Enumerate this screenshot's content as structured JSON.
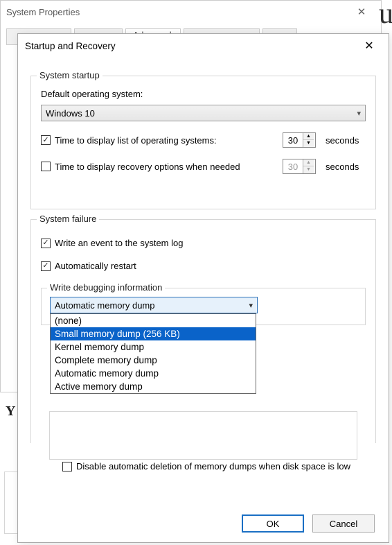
{
  "back_window": {
    "title": "System Properties",
    "tabs": {
      "advanced": "Advanced"
    }
  },
  "dialog": {
    "title": "Startup and Recovery"
  },
  "startup": {
    "group_label": "System startup",
    "default_os_label": "Default operating system:",
    "default_os_value": "Windows 10",
    "display_list_label": "Time to display list of operating systems:",
    "display_list_checked": true,
    "display_list_seconds": "30",
    "recovery_label": "Time to display recovery options when needed",
    "recovery_checked": false,
    "recovery_seconds": "30",
    "unit": "seconds"
  },
  "failure": {
    "group_label": "System failure",
    "write_event_label": "Write an event to the system log",
    "write_event_checked": true,
    "auto_restart_label": "Automatically restart",
    "auto_restart_checked": true,
    "debug_group_label": "Write debugging information",
    "combo_value": "Automatic memory dump",
    "combo_options": [
      "(none)",
      "Small memory dump (256 KB)",
      "Kernel memory dump",
      "Complete memory dump",
      "Automatic memory dump",
      "Active memory dump"
    ],
    "combo_highlight_index": 1,
    "disable_auto_delete_label": "Disable automatic deletion of memory dumps when disk space is low",
    "disable_auto_delete_checked": false
  },
  "buttons": {
    "ok": "OK",
    "cancel": "Cancel"
  }
}
